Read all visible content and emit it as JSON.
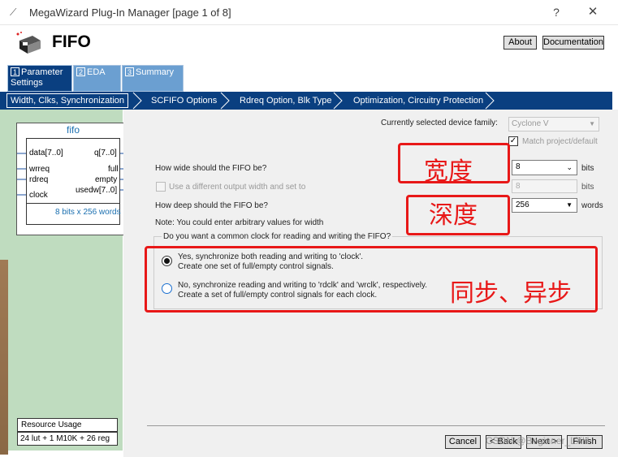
{
  "window": {
    "title": "MegaWizard Plug-In Manager [page 1 of 8]",
    "help": "?",
    "close": "✕"
  },
  "header": {
    "title": "FIFO",
    "about": "About",
    "documentation": "Documentation"
  },
  "steps": [
    {
      "num": "1",
      "label": "Parameter Settings"
    },
    {
      "num": "2",
      "label": "EDA"
    },
    {
      "num": "3",
      "label": "Summary"
    }
  ],
  "subtabs": [
    "Width, Clks, Synchronization",
    "SCFIFO Options",
    "Rdreq Option, Blk Type",
    "Optimization, Circuitry Protection"
  ],
  "symbol": {
    "name": "fifo",
    "inputs": [
      "data[7..0]",
      "wrreq",
      "rdreq",
      "clock"
    ],
    "outputs": [
      "q[7..0]",
      "full",
      "empty",
      "usedw[7..0]"
    ],
    "footer": "8 bits x 256 words"
  },
  "resource": {
    "label": "Resource Usage",
    "value": "24 lut + 1 M10K + 26 reg"
  },
  "form": {
    "device_family_label": "Currently selected device family:",
    "device_family_value": "Cyclone V",
    "match_label": "Match project/default",
    "width_question": "How wide should the FIFO be?",
    "width_value": "8",
    "width_unit": "bits",
    "diff_width_label": "Use a different output width and set to",
    "diff_width_value": "8",
    "diff_width_unit": "bits",
    "depth_question": "How deep should the FIFO be?",
    "depth_value": "256",
    "depth_unit": "words",
    "note": "Note: You could enter arbitrary values for width",
    "clock_question": "Do you want a common clock for reading and writing the FIFO?",
    "sync_line1": "Yes, synchronize both reading and writing to 'clock'.",
    "sync_line2": "Create one set of full/empty control signals.",
    "async_line1": "No, synchronize reading and writing to 'rdclk' and 'wrclk', respectively.",
    "async_line2": "Create a set of full/empty control signals for each clock."
  },
  "annotations": {
    "width": "宽度",
    "depth": "深度",
    "sync": "同步、异步"
  },
  "footer": {
    "cancel": "Cancel",
    "back": "< Back",
    "next": "Next >",
    "finish": "Finish",
    "watermark": "CSDN @Beginner_LXH"
  },
  "colors": {
    "annotation_red": "#e81818",
    "tab_active": "#0a3f80",
    "tab_inactive": "#6b9fd1",
    "left_panel": "#bfdcbf"
  }
}
